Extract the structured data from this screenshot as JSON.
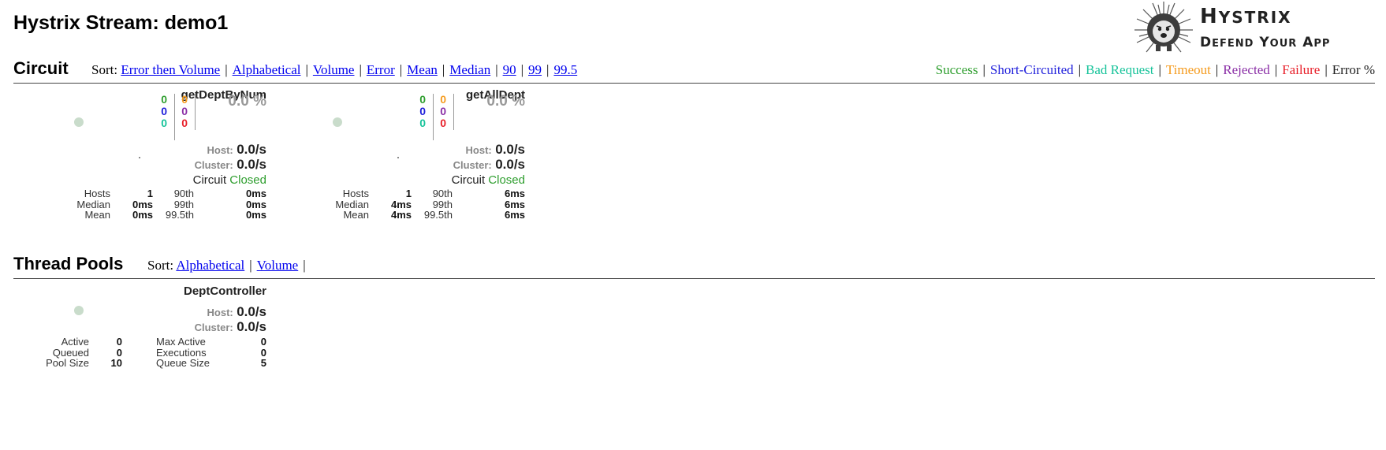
{
  "page": {
    "title": "Hystrix Stream: demo1"
  },
  "logo": {
    "line1_big": "H",
    "line1_small": "YSTRIX",
    "line2": [
      [
        "D",
        "EFEND"
      ],
      [
        "Y",
        "OUR"
      ],
      [
        "A",
        "PP"
      ]
    ]
  },
  "circuit_section": {
    "title": "Circuit",
    "sort_label": "Sort:",
    "sort_options": [
      "Error then Volume",
      "Alphabetical",
      "Volume",
      "Error",
      "Mean",
      "Median",
      "90",
      "99",
      "99.5"
    ],
    "legend": [
      {
        "label": "Success",
        "color": "#2e9e2e"
      },
      {
        "label": "Short-Circuited",
        "color": "#1f1fdb"
      },
      {
        "label": "Bad Request",
        "color": "#17c39a"
      },
      {
        "label": "Timeout",
        "color": "#f59b1e"
      },
      {
        "label": "Rejected",
        "color": "#8a2ea6"
      },
      {
        "label": "Failure",
        "color": "#e8202a"
      },
      {
        "label": "Error %",
        "color": "#222222"
      }
    ]
  },
  "circuits": [
    {
      "name": "getDeptByNum",
      "counts": {
        "success": "0",
        "short_circuited": "0",
        "bad_request": "0",
        "timeout": "0",
        "rejected": "0",
        "failure": "0"
      },
      "error_pct": "0.0 %",
      "host_label": "Host:",
      "host_rate": "0.0/s",
      "cluster_label": "Cluster:",
      "cluster_rate": "0.0/s",
      "circuit_label": "Circuit",
      "circuit_state": "Closed",
      "stats": {
        "hosts_label": "Hosts",
        "hosts": "1",
        "median_label": "Median",
        "median": "0ms",
        "mean_label": "Mean",
        "mean": "0ms",
        "p90_label": "90th",
        "p90": "0ms",
        "p99_label": "99th",
        "p99": "0ms",
        "p995_label": "99.5th",
        "p995": "0ms"
      }
    },
    {
      "name": "getAllDept",
      "counts": {
        "success": "0",
        "short_circuited": "0",
        "bad_request": "0",
        "timeout": "0",
        "rejected": "0",
        "failure": "0"
      },
      "error_pct": "0.0 %",
      "host_label": "Host:",
      "host_rate": "0.0/s",
      "cluster_label": "Cluster:",
      "cluster_rate": "0.0/s",
      "circuit_label": "Circuit",
      "circuit_state": "Closed",
      "stats": {
        "hosts_label": "Hosts",
        "hosts": "1",
        "median_label": "Median",
        "median": "4ms",
        "mean_label": "Mean",
        "mean": "4ms",
        "p90_label": "90th",
        "p90": "6ms",
        "p99_label": "99th",
        "p99": "6ms",
        "p995_label": "99.5th",
        "p995": "6ms"
      }
    }
  ],
  "threadpool_section": {
    "title": "Thread Pools",
    "sort_label": "Sort:",
    "sort_options": [
      "Alphabetical",
      "Volume"
    ]
  },
  "threadpools": [
    {
      "name": "DeptController",
      "host_label": "Host:",
      "host_rate": "0.0/s",
      "cluster_label": "Cluster:",
      "cluster_rate": "0.0/s",
      "stats": {
        "active_label": "Active",
        "active": "0",
        "queued_label": "Queued",
        "queued": "0",
        "pool_size_label": "Pool Size",
        "pool_size": "10",
        "max_active_label": "Max Active",
        "max_active": "0",
        "executions_label": "Executions",
        "executions": "0",
        "queue_size_label": "Queue Size",
        "queue_size": "5"
      }
    }
  ]
}
